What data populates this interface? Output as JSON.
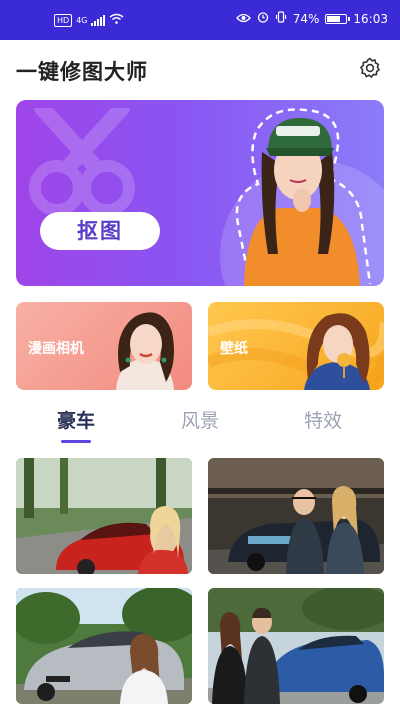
{
  "status_bar": {
    "hd": "HD",
    "network": "4G",
    "battery": "74%",
    "battery_level": 0.74,
    "time": "16:03"
  },
  "header": {
    "title": "一键修图大师",
    "settings_icon": "gear-icon"
  },
  "hero": {
    "button_label": "抠图",
    "bg_icon": "scissors-icon",
    "colors": {
      "start": "#9f45e8",
      "end": "#8b7cf8"
    }
  },
  "cards": [
    {
      "label": "漫画相机",
      "color": "#f49b8f"
    },
    {
      "label": "壁纸",
      "color": "#fbb93a"
    }
  ],
  "tabs": [
    {
      "label": "豪车",
      "active": true
    },
    {
      "label": "风景",
      "active": false
    },
    {
      "label": "特效",
      "active": false
    }
  ],
  "accent_color": "#5b46e1",
  "status_bar_color": "#3b2bd6"
}
